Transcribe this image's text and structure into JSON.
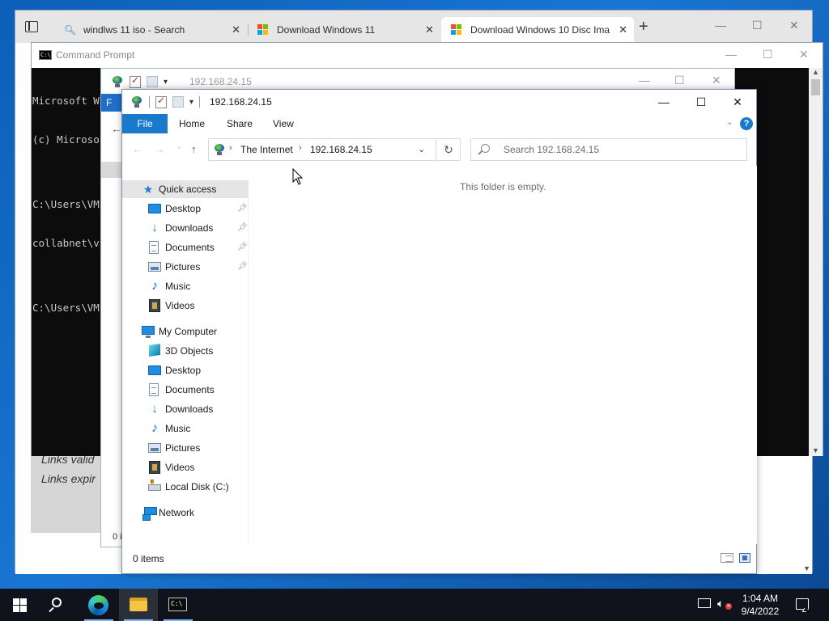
{
  "browser": {
    "tabs": [
      {
        "label": "windlws 11 iso - Search",
        "icon": "search-icon",
        "active": false
      },
      {
        "label": "Download Windows 11",
        "icon": "microsoft-logo-icon",
        "active": false
      },
      {
        "label": "Download Windows 10 Disc Ima",
        "icon": "microsoft-logo-icon",
        "active": true
      }
    ],
    "close_glyph": "✕",
    "new_tab_glyph": "+",
    "window_controls": {
      "minimize": "—",
      "maximize": "☐",
      "close": "✕"
    },
    "page_text": [
      "Links valid",
      "Links expir"
    ]
  },
  "cmd": {
    "title": "Command Prompt",
    "icon_text": "C:\\",
    "lines": [
      "Microsoft W",
      "(c) Microso",
      "",
      "C:\\Users\\VM",
      "collabnet\\v",
      "",
      "C:\\Users\\VM"
    ],
    "window_controls": {
      "minimize": "—",
      "maximize": "☐",
      "close": "✕"
    }
  },
  "explorer_bg": {
    "address": "192.168.24.15",
    "file_tab": "F",
    "status": "0 i",
    "window_controls": {
      "minimize": "—",
      "maximize": "☐",
      "close": "✕"
    }
  },
  "explorer": {
    "title": "192.168.24.15",
    "window_controls": {
      "minimize": "—",
      "maximize": "☐",
      "close": "✕"
    },
    "ribbon": {
      "file": "File",
      "home": "Home",
      "share": "Share",
      "view": "View",
      "help": "?"
    },
    "nav": {
      "back": "←",
      "forward": "→",
      "recent": "⌄",
      "up": "↑",
      "refresh": "↻"
    },
    "address": {
      "crumbs": [
        "The Internet",
        "192.168.24.15"
      ],
      "separator": "›"
    },
    "search": {
      "placeholder": "Search 192.168.24.15"
    },
    "navpane": {
      "quick_access": "Quick access",
      "quick_items": [
        {
          "label": "Desktop",
          "icon": "desktop-icon",
          "pinned": true
        },
        {
          "label": "Downloads",
          "icon": "downloads-icon",
          "pinned": true
        },
        {
          "label": "Documents",
          "icon": "documents-icon",
          "pinned": true
        },
        {
          "label": "Pictures",
          "icon": "pictures-icon",
          "pinned": true
        },
        {
          "label": "Music",
          "icon": "music-icon",
          "pinned": false
        },
        {
          "label": "Videos",
          "icon": "videos-icon",
          "pinned": false
        }
      ],
      "this_pc": "My Computer",
      "pc_items": [
        {
          "label": "3D Objects",
          "icon": "3d-objects-icon"
        },
        {
          "label": "Desktop",
          "icon": "desktop-icon"
        },
        {
          "label": "Documents",
          "icon": "documents-icon"
        },
        {
          "label": "Downloads",
          "icon": "downloads-icon"
        },
        {
          "label": "Music",
          "icon": "music-icon"
        },
        {
          "label": "Pictures",
          "icon": "pictures-icon"
        },
        {
          "label": "Videos",
          "icon": "videos-icon"
        },
        {
          "label": "Local Disk (C:)",
          "icon": "local-disk-icon"
        }
      ],
      "network": "Network",
      "pin_glyph": "📌"
    },
    "empty_message": "This folder is empty.",
    "status": {
      "item_count": "0 items"
    }
  },
  "taskbar": {
    "apps": [
      {
        "name": "start",
        "icon": "windows-start-icon"
      },
      {
        "name": "search",
        "icon": "search-icon"
      },
      {
        "name": "edge",
        "icon": "edge-browser-icon"
      },
      {
        "name": "file-explorer",
        "icon": "file-explorer-icon"
      },
      {
        "name": "command-prompt",
        "icon": "command-prompt-icon"
      }
    ],
    "cmd_icon_text": "C:\\",
    "tray": {
      "network": "network-icon",
      "volume": "volume-muted-icon",
      "muted_mark": "✕"
    },
    "clock": {
      "time": "1:04 AM",
      "date": "9/4/2022"
    },
    "notifications": "notifications-icon"
  },
  "colors": {
    "accent": "#1979ca",
    "taskbar": "#10131c",
    "desktop": "#0c5fb8",
    "console_bg": "#0c0c0c"
  }
}
